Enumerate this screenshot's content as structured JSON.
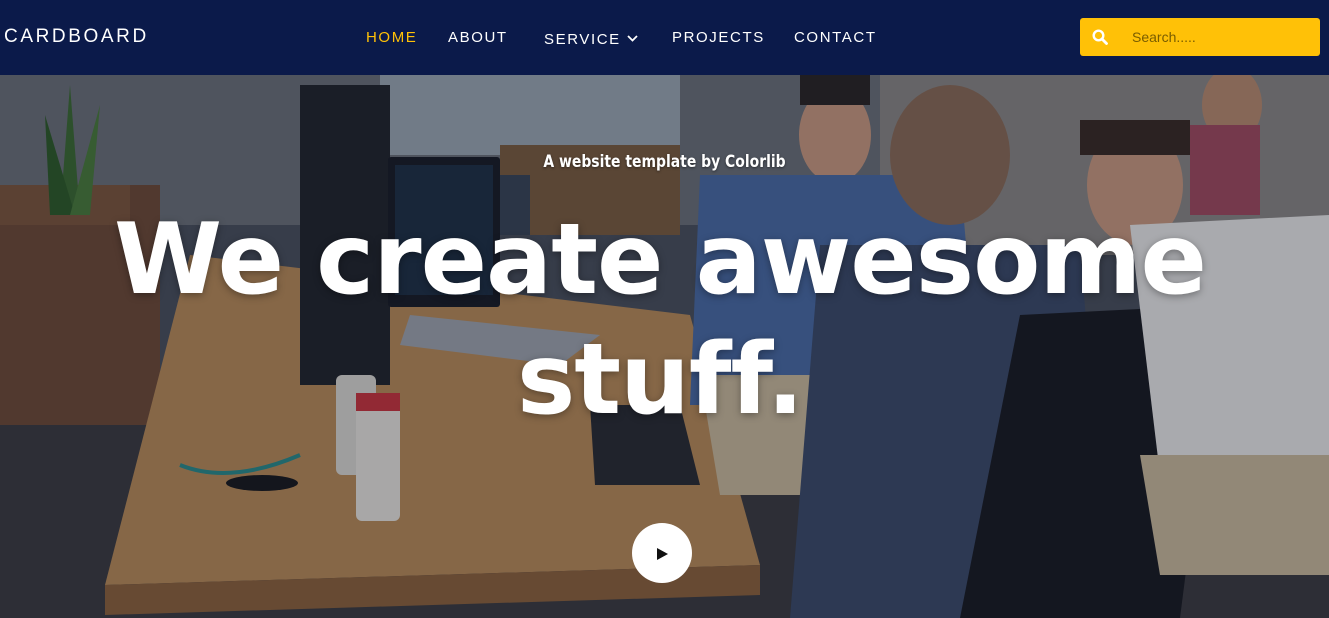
{
  "header": {
    "brand": "CARDBOARD",
    "nav": [
      {
        "label": "HOME",
        "active": true
      },
      {
        "label": "ABOUT",
        "active": false
      },
      {
        "label": "SERVICE",
        "active": false,
        "has_dropdown": true
      },
      {
        "label": "PROJECTS",
        "active": false
      },
      {
        "label": "CONTACT",
        "active": false
      }
    ],
    "search": {
      "placeholder": "Search.....",
      "value": "",
      "icon": "search-icon"
    }
  },
  "hero": {
    "subtitle": "A website template by Colorlib",
    "headline": "We create awesome stuff.",
    "play_icon": "play-icon"
  },
  "colors": {
    "header_bg": "#0b1a4a",
    "accent": "#ffc107",
    "text": "#ffffff"
  }
}
